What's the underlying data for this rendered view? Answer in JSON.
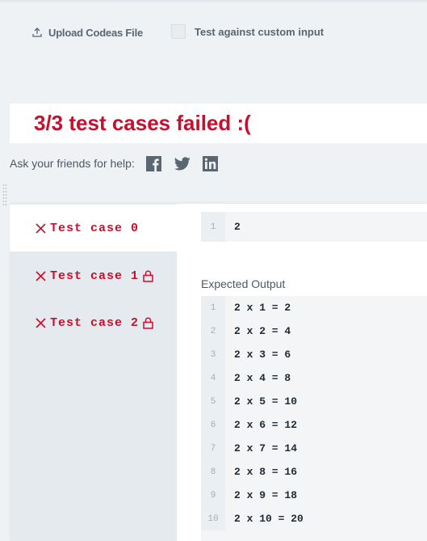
{
  "toolbar": {
    "upload_label": "Upload Codeas File",
    "custom_input_label": "Test against custom input",
    "custom_input_checked": false
  },
  "result": {
    "title": "3/3 test cases failed :("
  },
  "help": {
    "label": "Ask your friends for help:",
    "icons": [
      "facebook-icon",
      "twitter-icon",
      "linkedin-icon"
    ]
  },
  "test_cases": [
    {
      "label": "Test case 0",
      "locked": false,
      "active": true
    },
    {
      "label": "Test case 1",
      "locked": true,
      "active": false
    },
    {
      "label": "Test case 2",
      "locked": true,
      "active": false
    }
  ],
  "input_block": {
    "lines": [
      {
        "n": "1",
        "text": "2"
      }
    ]
  },
  "expected": {
    "label": "Expected Output",
    "lines": [
      {
        "n": "1",
        "text": "2 x 1 = 2"
      },
      {
        "n": "2",
        "text": "2 x 2 = 4"
      },
      {
        "n": "3",
        "text": "2 x 3 = 6"
      },
      {
        "n": "4",
        "text": "2 x 4 = 8"
      },
      {
        "n": "5",
        "text": "2 x 5 = 10"
      },
      {
        "n": "6",
        "text": "2 x 6 = 12"
      },
      {
        "n": "7",
        "text": "2 x 7 = 14"
      },
      {
        "n": "8",
        "text": "2 x 8 = 16"
      },
      {
        "n": "9",
        "text": "2 x 9 = 18"
      },
      {
        "n": "10",
        "text": "2 x 10 = 20"
      }
    ]
  },
  "colors": {
    "fail_red": "#c8102e",
    "background": "#eef2f5"
  }
}
